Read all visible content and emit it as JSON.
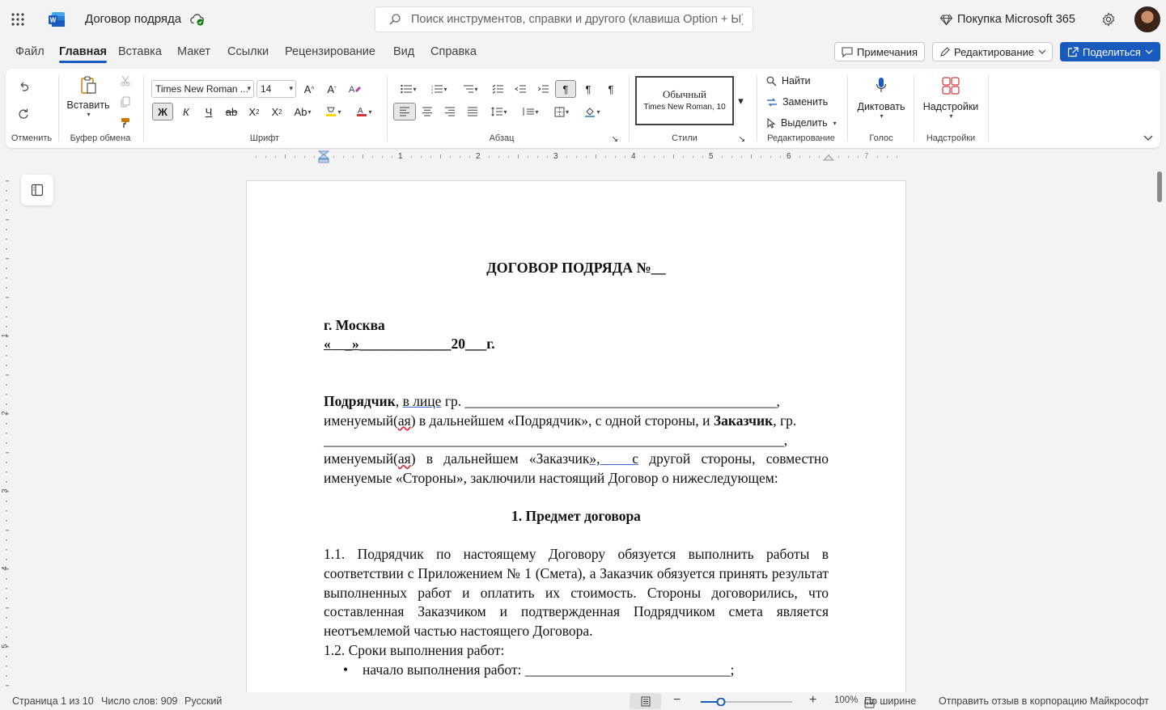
{
  "app": {
    "doc_title": "Договор подряда",
    "search_placeholder": "Поиск инструментов, справки и другого (клавиша Option + Ы)",
    "buy_label": "Покупка Microsoft 365"
  },
  "menu": {
    "tabs": [
      "Файл",
      "Главная",
      "Вставка",
      "Макет",
      "Ссылки",
      "Рецензирование",
      "Вид",
      "Справка"
    ],
    "active": "Главная",
    "comments_label": "Примечания",
    "editing_label": "Редактирование",
    "share_label": "Поделиться"
  },
  "ribbon": {
    "undo_group": "Отменить",
    "paste_label": "Вставить",
    "clipboard_group": "Буфер обмена",
    "font_name": "Times New Roman ...",
    "font_size": "14",
    "bold": "Ж",
    "italic": "К",
    "underline": "Ч",
    "font_group": "Шрифт",
    "paragraph_group": "Абзац",
    "style_name": "Обычный",
    "style_desc": "Times New Roman, 10",
    "styles_group": "Стили",
    "find_label": "Найти",
    "replace_label": "Заменить",
    "select_label": "Выделить",
    "editing_group": "Редактирование",
    "dictate_label": "Диктовать",
    "voice_group": "Голос",
    "addins_label": "Надстройки",
    "addins_group": "Надстройки"
  },
  "ruler": {
    "numbers": [
      "1",
      "2",
      "3",
      "4",
      "5",
      "6",
      "7"
    ],
    "v_numbers": [
      "1",
      "2",
      "3",
      "4",
      "5"
    ]
  },
  "document": {
    "heading": "ДОГОВОР ПОДРЯДА №__",
    "city": "г. Москва",
    "date_open": "«",
    "date_day": "    _»",
    "date_mid": "_____________20___г.",
    "p1_contractor": "Подрядчик",
    "p1_comma": ", ",
    "p1_inperson": "в  лице",
    "p1_rest": " гр. ____________________________________________,",
    "p2_a": "именуемый(",
    "p2_sq": "ая",
    "p2_b": ") в дальнейшем «Подрядчик», с одной стороны, и ",
    "p2_customer": "Заказчик",
    "p2_c": ", гр.",
    "p3_line": "_________________________________________________________________,",
    "p4_a": "именуемый(",
    "p4_sq": "ая",
    "p4_b": ") в дальнейшем «Заказчик",
    "p4_u": "»,   с",
    "p4_c": " другой стороны, совместно именуемые «Стороны», заключили настоящий Договор о нижеследующем:",
    "section1": "1.  Предмет договора",
    "clause_1_1": "1.1. Подрядчик по настоящему Договору обязуется выполнить работы в соответствии с Приложением № 1 (Смета), а Заказчик обязуется принять результат выполненных работ и оплатить их стоимость. Стороны договорились, что составленная Заказчиком и подтвержденная Подрядчиком смета является неотъемлемой частью настоящего Договора.",
    "clause_1_2": "1.2. Сроки выполнения работ:",
    "bullet_1": "начало выполнения работ: _____________________________;"
  },
  "status": {
    "page": "Страница 1 из 10",
    "words": "Число слов: 909",
    "language": "Русский",
    "zoom": "100%",
    "fit_label": "По ширине",
    "feedback": "Отправить отзыв в корпорацию Майкрософт"
  },
  "colors": {
    "accent": "#185abd",
    "word_blue": "#185abd"
  }
}
